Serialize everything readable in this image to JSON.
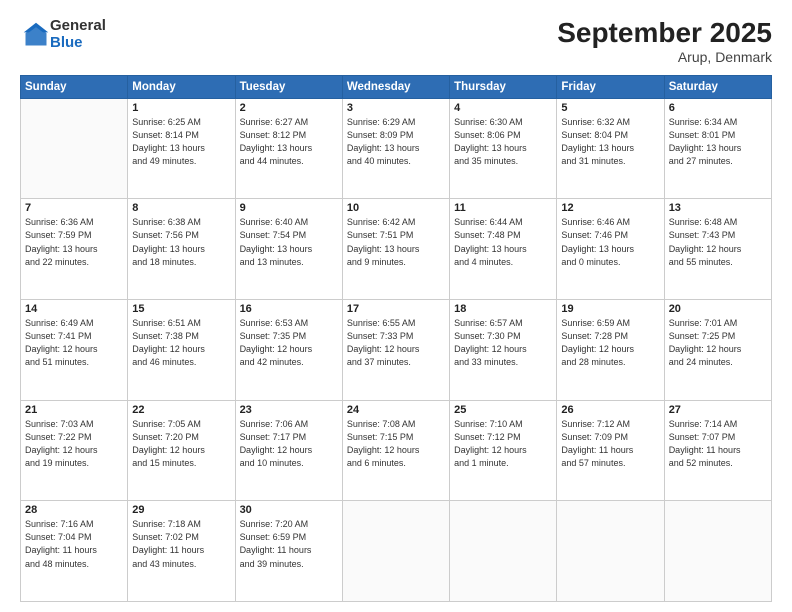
{
  "logo": {
    "general": "General",
    "blue": "Blue"
  },
  "header": {
    "month": "September 2025",
    "location": "Arup, Denmark"
  },
  "weekdays": [
    "Sunday",
    "Monday",
    "Tuesday",
    "Wednesday",
    "Thursday",
    "Friday",
    "Saturday"
  ],
  "weeks": [
    [
      {
        "day": "",
        "info": ""
      },
      {
        "day": "1",
        "info": "Sunrise: 6:25 AM\nSunset: 8:14 PM\nDaylight: 13 hours\nand 49 minutes."
      },
      {
        "day": "2",
        "info": "Sunrise: 6:27 AM\nSunset: 8:12 PM\nDaylight: 13 hours\nand 44 minutes."
      },
      {
        "day": "3",
        "info": "Sunrise: 6:29 AM\nSunset: 8:09 PM\nDaylight: 13 hours\nand 40 minutes."
      },
      {
        "day": "4",
        "info": "Sunrise: 6:30 AM\nSunset: 8:06 PM\nDaylight: 13 hours\nand 35 minutes."
      },
      {
        "day": "5",
        "info": "Sunrise: 6:32 AM\nSunset: 8:04 PM\nDaylight: 13 hours\nand 31 minutes."
      },
      {
        "day": "6",
        "info": "Sunrise: 6:34 AM\nSunset: 8:01 PM\nDaylight: 13 hours\nand 27 minutes."
      }
    ],
    [
      {
        "day": "7",
        "info": "Sunrise: 6:36 AM\nSunset: 7:59 PM\nDaylight: 13 hours\nand 22 minutes."
      },
      {
        "day": "8",
        "info": "Sunrise: 6:38 AM\nSunset: 7:56 PM\nDaylight: 13 hours\nand 18 minutes."
      },
      {
        "day": "9",
        "info": "Sunrise: 6:40 AM\nSunset: 7:54 PM\nDaylight: 13 hours\nand 13 minutes."
      },
      {
        "day": "10",
        "info": "Sunrise: 6:42 AM\nSunset: 7:51 PM\nDaylight: 13 hours\nand 9 minutes."
      },
      {
        "day": "11",
        "info": "Sunrise: 6:44 AM\nSunset: 7:48 PM\nDaylight: 13 hours\nand 4 minutes."
      },
      {
        "day": "12",
        "info": "Sunrise: 6:46 AM\nSunset: 7:46 PM\nDaylight: 13 hours\nand 0 minutes."
      },
      {
        "day": "13",
        "info": "Sunrise: 6:48 AM\nSunset: 7:43 PM\nDaylight: 12 hours\nand 55 minutes."
      }
    ],
    [
      {
        "day": "14",
        "info": "Sunrise: 6:49 AM\nSunset: 7:41 PM\nDaylight: 12 hours\nand 51 minutes."
      },
      {
        "day": "15",
        "info": "Sunrise: 6:51 AM\nSunset: 7:38 PM\nDaylight: 12 hours\nand 46 minutes."
      },
      {
        "day": "16",
        "info": "Sunrise: 6:53 AM\nSunset: 7:35 PM\nDaylight: 12 hours\nand 42 minutes."
      },
      {
        "day": "17",
        "info": "Sunrise: 6:55 AM\nSunset: 7:33 PM\nDaylight: 12 hours\nand 37 minutes."
      },
      {
        "day": "18",
        "info": "Sunrise: 6:57 AM\nSunset: 7:30 PM\nDaylight: 12 hours\nand 33 minutes."
      },
      {
        "day": "19",
        "info": "Sunrise: 6:59 AM\nSunset: 7:28 PM\nDaylight: 12 hours\nand 28 minutes."
      },
      {
        "day": "20",
        "info": "Sunrise: 7:01 AM\nSunset: 7:25 PM\nDaylight: 12 hours\nand 24 minutes."
      }
    ],
    [
      {
        "day": "21",
        "info": "Sunrise: 7:03 AM\nSunset: 7:22 PM\nDaylight: 12 hours\nand 19 minutes."
      },
      {
        "day": "22",
        "info": "Sunrise: 7:05 AM\nSunset: 7:20 PM\nDaylight: 12 hours\nand 15 minutes."
      },
      {
        "day": "23",
        "info": "Sunrise: 7:06 AM\nSunset: 7:17 PM\nDaylight: 12 hours\nand 10 minutes."
      },
      {
        "day": "24",
        "info": "Sunrise: 7:08 AM\nSunset: 7:15 PM\nDaylight: 12 hours\nand 6 minutes."
      },
      {
        "day": "25",
        "info": "Sunrise: 7:10 AM\nSunset: 7:12 PM\nDaylight: 12 hours\nand 1 minute."
      },
      {
        "day": "26",
        "info": "Sunrise: 7:12 AM\nSunset: 7:09 PM\nDaylight: 11 hours\nand 57 minutes."
      },
      {
        "day": "27",
        "info": "Sunrise: 7:14 AM\nSunset: 7:07 PM\nDaylight: 11 hours\nand 52 minutes."
      }
    ],
    [
      {
        "day": "28",
        "info": "Sunrise: 7:16 AM\nSunset: 7:04 PM\nDaylight: 11 hours\nand 48 minutes."
      },
      {
        "day": "29",
        "info": "Sunrise: 7:18 AM\nSunset: 7:02 PM\nDaylight: 11 hours\nand 43 minutes."
      },
      {
        "day": "30",
        "info": "Sunrise: 7:20 AM\nSunset: 6:59 PM\nDaylight: 11 hours\nand 39 minutes."
      },
      {
        "day": "",
        "info": ""
      },
      {
        "day": "",
        "info": ""
      },
      {
        "day": "",
        "info": ""
      },
      {
        "day": "",
        "info": ""
      }
    ]
  ]
}
